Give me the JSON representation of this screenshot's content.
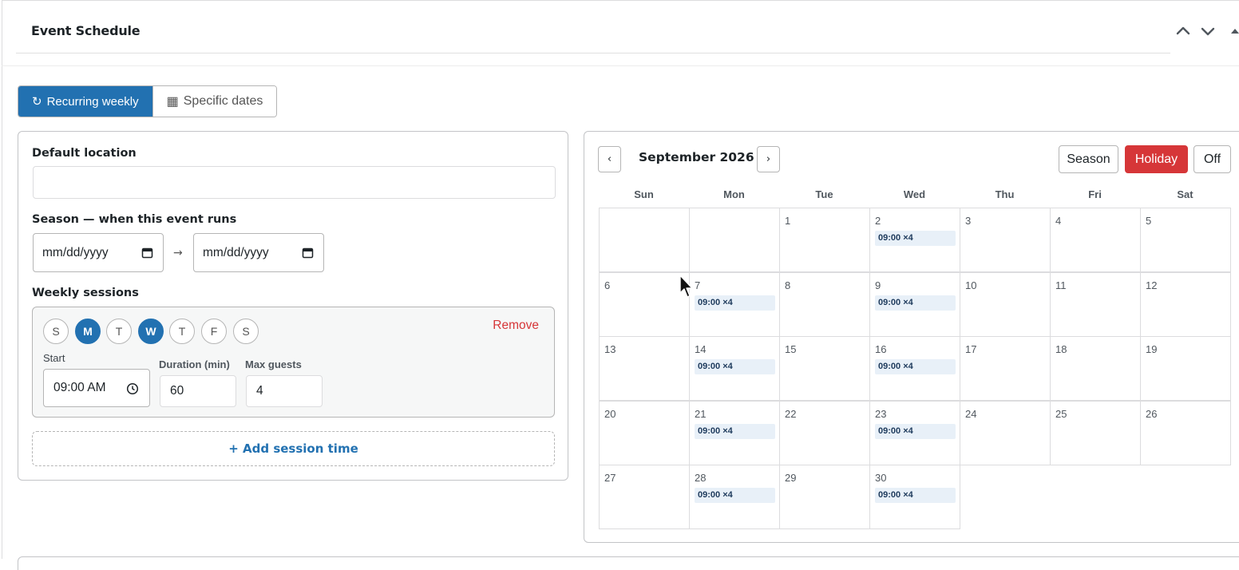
{
  "panel": {
    "title": "Event Schedule"
  },
  "mode_tabs": [
    {
      "glyph": "↻",
      "label": "Recurring weekly",
      "active": true
    },
    {
      "glyph": "▦",
      "label": "Specific dates",
      "active": false
    }
  ],
  "form": {
    "location_label": "Default location",
    "location_value": "",
    "season_label": "Season — when this event runs",
    "season_start_placeholder": "mm/dd/yyyy",
    "season_arrow": "→",
    "season_end_placeholder": "mm/dd/yyyy",
    "weekly_label": "Weekly sessions",
    "session": {
      "days": [
        {
          "label": "S",
          "on": false
        },
        {
          "label": "M",
          "on": true
        },
        {
          "label": "T",
          "on": false
        },
        {
          "label": "W",
          "on": true
        },
        {
          "label": "T",
          "on": false
        },
        {
          "label": "F",
          "on": false
        },
        {
          "label": "S",
          "on": false
        }
      ],
      "remove_label": "Remove",
      "start_label": "Start",
      "start_value": "09:00 AM",
      "duration_label": "Duration (min)",
      "duration_value": "60",
      "max_guests_label": "Max guests",
      "max_guests_value": "4"
    },
    "add_session_label": "+ Add session time"
  },
  "calendar": {
    "prev_label": "‹",
    "next_label": "›",
    "month_title": "September 2026",
    "mode_buttons": [
      {
        "label": "Season",
        "active": false
      },
      {
        "label": "Holiday",
        "active": true
      },
      {
        "label": "Off",
        "active": false
      }
    ],
    "weekdays": [
      "Sun",
      "Mon",
      "Tue",
      "Wed",
      "Thu",
      "Fri",
      "Sat"
    ],
    "weeks": [
      [
        {
          "day": ""
        },
        {
          "day": ""
        },
        {
          "day": "1"
        },
        {
          "day": "2",
          "chip": "09:00 ×4"
        },
        {
          "day": "3"
        },
        {
          "day": "4"
        },
        {
          "day": "5"
        }
      ],
      [
        {
          "day": "6"
        },
        {
          "day": "7",
          "chip": "09:00 ×4"
        },
        {
          "day": "8"
        },
        {
          "day": "9",
          "chip": "09:00 ×4"
        },
        {
          "day": "10"
        },
        {
          "day": "11"
        },
        {
          "day": "12"
        }
      ],
      [
        {
          "day": "13"
        },
        {
          "day": "14",
          "chip": "09:00 ×4"
        },
        {
          "day": "15"
        },
        {
          "day": "16",
          "chip": "09:00 ×4"
        },
        {
          "day": "17"
        },
        {
          "day": "18"
        },
        {
          "day": "19"
        }
      ],
      [
        {
          "day": "20"
        },
        {
          "day": "21",
          "chip": "09:00 ×4"
        },
        {
          "day": "22"
        },
        {
          "day": "23",
          "chip": "09:00 ×4"
        },
        {
          "day": "24"
        },
        {
          "day": "25"
        },
        {
          "day": "26"
        }
      ],
      [
        {
          "day": "27"
        },
        {
          "day": "28",
          "chip": "09:00 ×4"
        },
        {
          "day": "29"
        },
        {
          "day": "30",
          "chip": "09:00 ×4"
        }
      ]
    ]
  },
  "colors": {
    "accent": "#2271b1",
    "danger": "#d63638",
    "chip_bg": "#e8f0f8"
  }
}
